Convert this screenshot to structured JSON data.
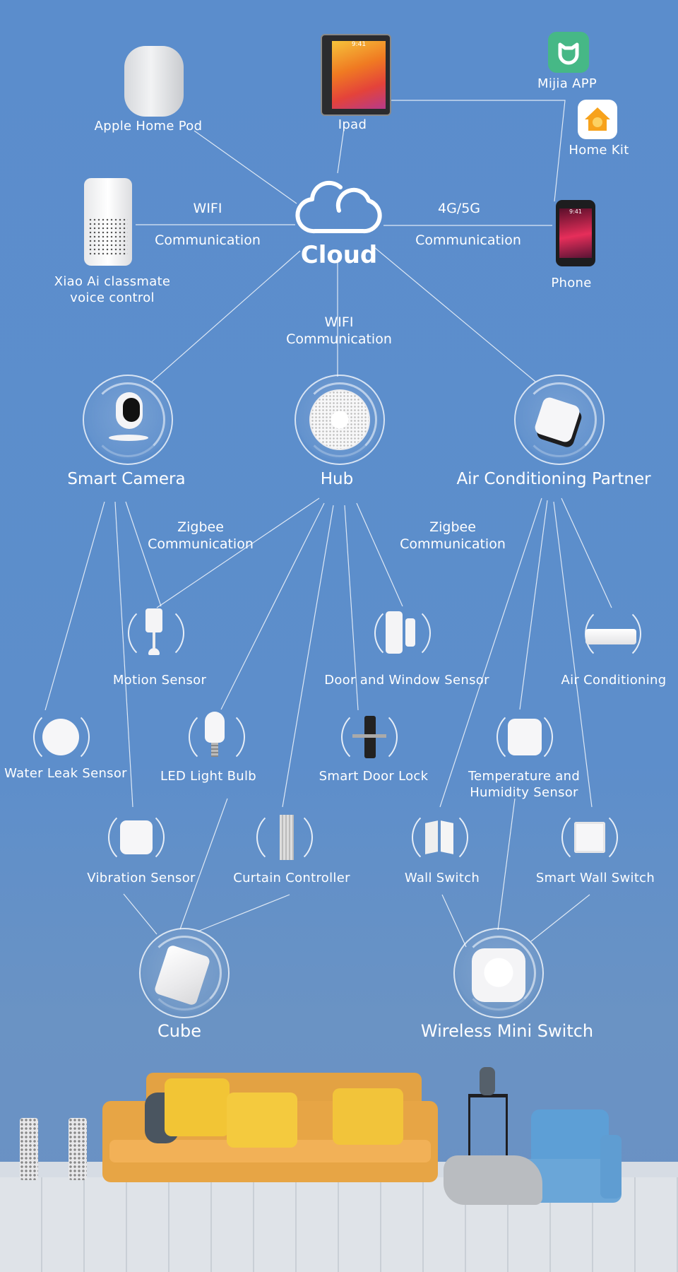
{
  "top_devices": {
    "homepod": "Apple Home Pod",
    "ipad": "Ipad",
    "mijia": "Mijia APP",
    "homekit": "Home Kit",
    "xiaoai_line1": "Xiao Ai classmate",
    "xiaoai_line2": "voice control",
    "phone": "Phone"
  },
  "cloud": {
    "label": "Cloud",
    "left_link": {
      "line1": "WIFI",
      "line2": "Communication"
    },
    "right_link": {
      "line1": "4G/5G",
      "line2": "Communication"
    },
    "down_link": {
      "line1": "WIFI",
      "line2": "Communication"
    }
  },
  "gateways": {
    "camera": "Smart Camera",
    "hub": "Hub",
    "ac_partner": "Air Conditioning Partner",
    "zigbee_left": {
      "line1": "Zigbee",
      "line2": "Communication"
    },
    "zigbee_right": {
      "line1": "Zigbee",
      "line2": "Communication"
    }
  },
  "sub_devices": {
    "motion": "Motion Sensor",
    "door_window": "Door and Window Sensor",
    "air_conditioning": "Air Conditioning",
    "water_leak": "Water Leak Sensor",
    "led_bulb": "LED Light Bulb",
    "door_lock": "Smart Door Lock",
    "temp_line1": "Temperature and",
    "temp_line2": "Humidity Sensor",
    "vibration": "Vibration Sensor",
    "curtain": "Curtain Controller",
    "wall_switch": "Wall Switch",
    "smart_wall_switch": "Smart Wall Switch"
  },
  "controllers": {
    "cube": "Cube",
    "mini_switch": "Wireless Mini Switch"
  },
  "screens": {
    "ipad_time": "9:41",
    "phone_time": "9:41"
  },
  "colors": {
    "background": "#5b8dcc",
    "mijia_green": "#46b886",
    "homekit_orange": "#f7a21b",
    "sofa": "#e8a443",
    "chair": "#6aa6d8"
  }
}
